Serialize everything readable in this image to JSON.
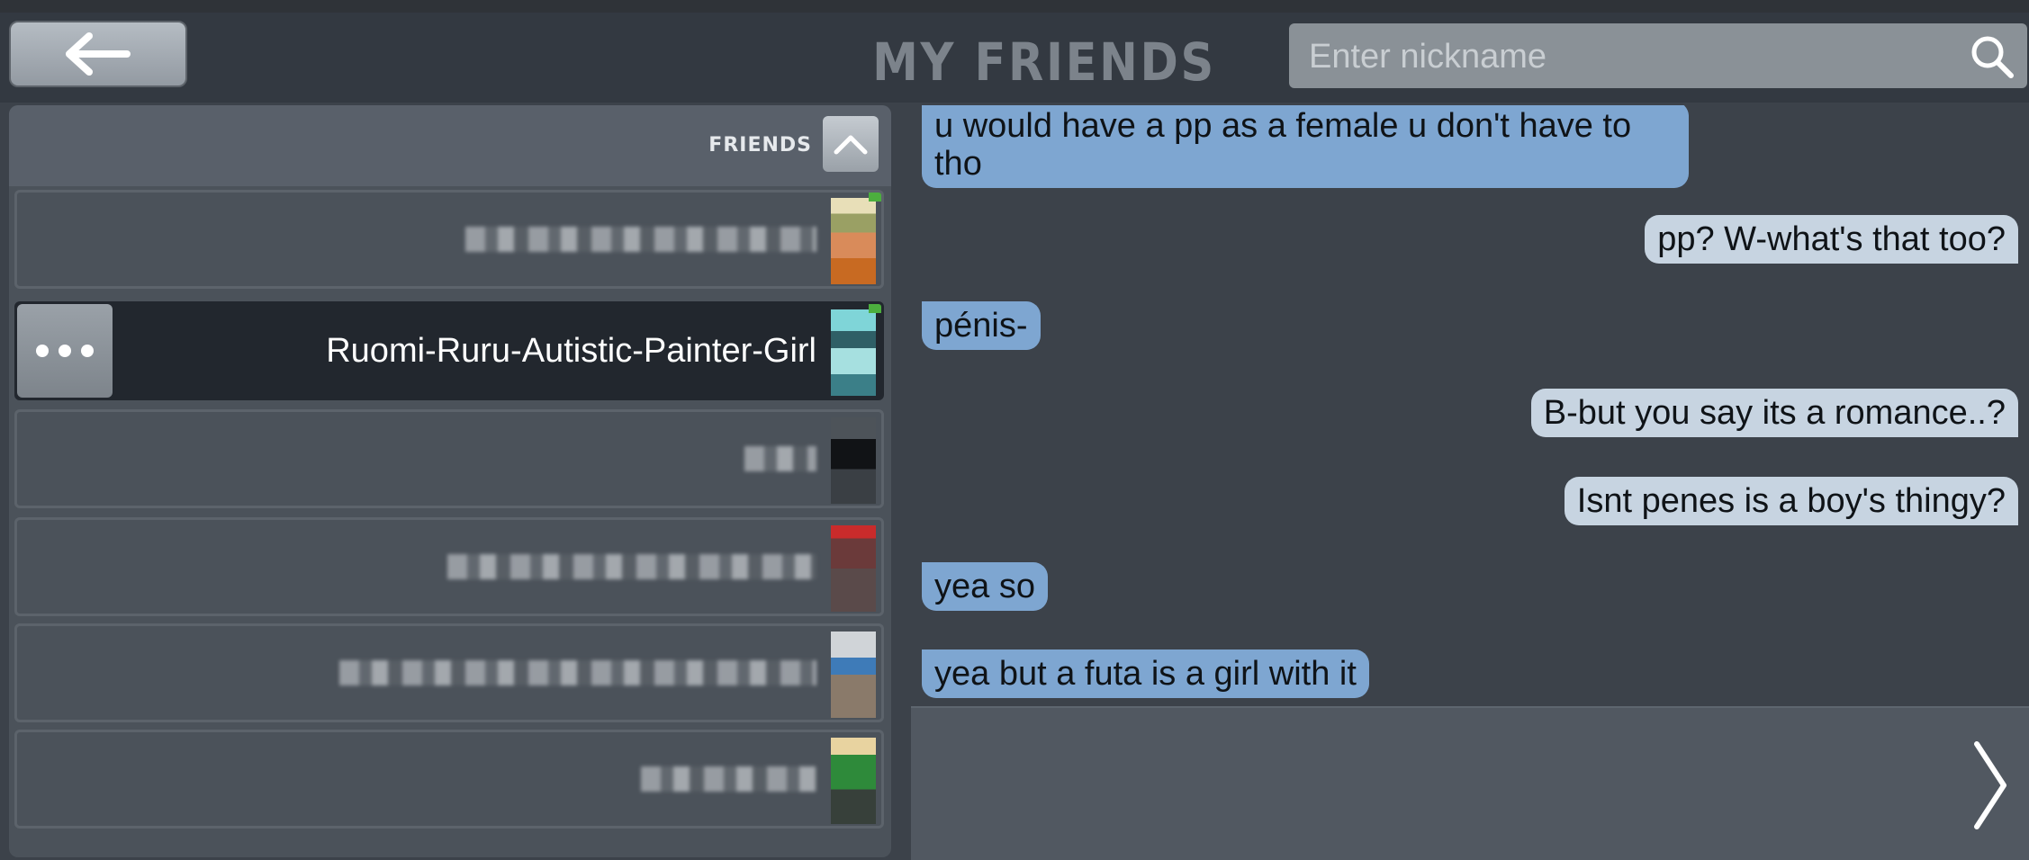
{
  "header": {
    "title": "MY FRIENDS",
    "search_placeholder": "Enter nickname",
    "back_icon": "arrow-left-icon",
    "search_icon": "search-icon"
  },
  "friends_panel": {
    "label": "FRIENDS",
    "collapse_icon": "chevron-up-icon",
    "friends": [
      {
        "name": "",
        "blurred": true
      },
      {
        "name": "Ruomi-Ruru-Autistic-Painter-Girl",
        "blurred": false,
        "selected": true
      },
      {
        "name": "",
        "blurred": true
      },
      {
        "name": "",
        "blurred": true
      },
      {
        "name": "",
        "blurred": true
      },
      {
        "name": "",
        "blurred": true
      }
    ]
  },
  "chat": {
    "messages": [
      {
        "from": "them",
        "text": "u would have a pp as a female u don't have to tho"
      },
      {
        "from": "me",
        "text": "pp? W-what's that too?"
      },
      {
        "from": "them",
        "text": "pénis-"
      },
      {
        "from": "me",
        "text": "B-but you say its a romance..?"
      },
      {
        "from": "me",
        "text": "Isnt penes is a boy's thingy?"
      },
      {
        "from": "them",
        "text": "yea so"
      },
      {
        "from": "them",
        "text": "yea but a futa is a girl with it"
      }
    ],
    "send_icon": "chevron-right-icon"
  },
  "colors": {
    "incoming_bubble": "#7ea6d1",
    "outgoing_bubble": "#c7d4e1",
    "selected_row": "#22272e"
  }
}
